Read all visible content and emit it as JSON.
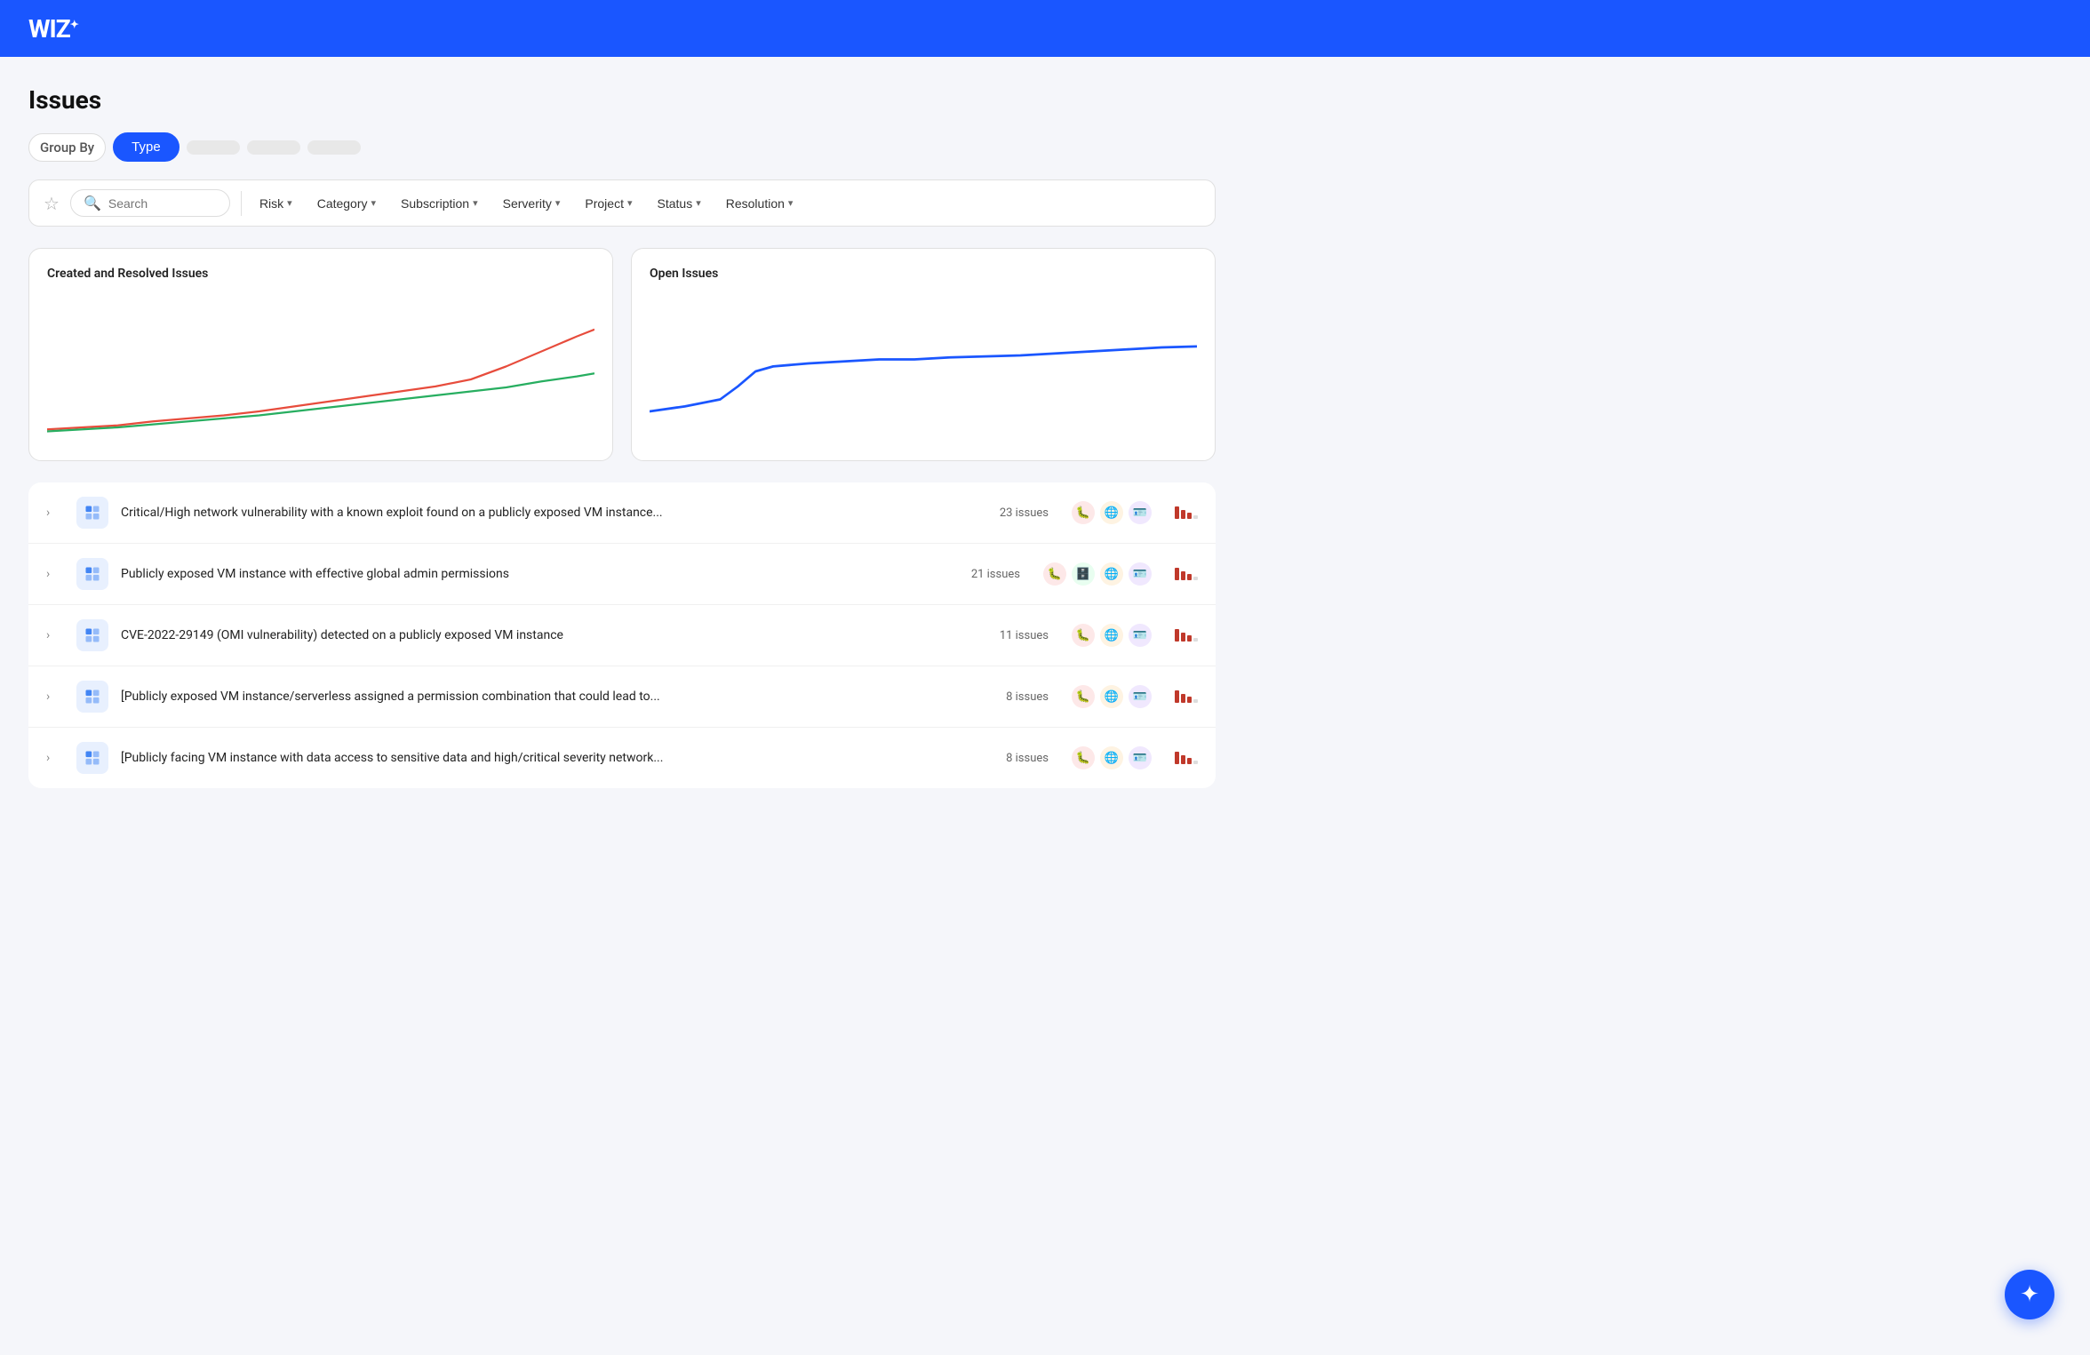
{
  "header": {
    "logo": "WIZ",
    "logo_star": "✦"
  },
  "page": {
    "title": "Issues"
  },
  "group_by": {
    "label": "Group By",
    "options": [
      {
        "label": "Type",
        "active": true,
        "blurred": false
      },
      {
        "label": "",
        "active": false,
        "blurred": true
      },
      {
        "label": "",
        "active": false,
        "blurred": true
      },
      {
        "label": "",
        "active": false,
        "blurred": true
      }
    ]
  },
  "filters": {
    "search_placeholder": "Search",
    "items": [
      {
        "label": "Risk"
      },
      {
        "label": "Category"
      },
      {
        "label": "Subscription"
      },
      {
        "label": "Serverity"
      },
      {
        "label": "Project"
      },
      {
        "label": "Status"
      },
      {
        "label": "Resolution"
      }
    ]
  },
  "charts": {
    "created_resolved": {
      "title": "Created and Resolved Issues"
    },
    "open_issues": {
      "title": "Open Issues"
    }
  },
  "issues": [
    {
      "title": "Critical/High network vulnerability with a known exploit found on a publicly exposed VM instance...",
      "count": "23 issues",
      "badges": [
        "bug-red",
        "globe-orange",
        "id-purple"
      ]
    },
    {
      "title": "Publicly exposed VM instance with effective global admin permissions",
      "count": "21 issues",
      "badges": [
        "bug-red",
        "db-green",
        "globe-orange",
        "id-purple"
      ]
    },
    {
      "title": "CVE-2022-29149 (OMI vulnerability) detected on a publicly exposed VM instance",
      "count": "11 issues",
      "badges": [
        "bug-red",
        "globe-orange",
        "id-purple"
      ]
    },
    {
      "title": "[Publicly exposed VM instance/serverless assigned a permission combination that could lead to...",
      "count": "8 issues",
      "badges": [
        "bug-red",
        "globe-orange",
        "id-purple"
      ]
    },
    {
      "title": "[Publicly facing VM instance with data access to sensitive data and high/critical severity network...",
      "count": "8 issues",
      "badges": [
        "bug-red",
        "globe-orange",
        "id-purple"
      ]
    }
  ],
  "floating_btn": {
    "icon": "✦"
  }
}
